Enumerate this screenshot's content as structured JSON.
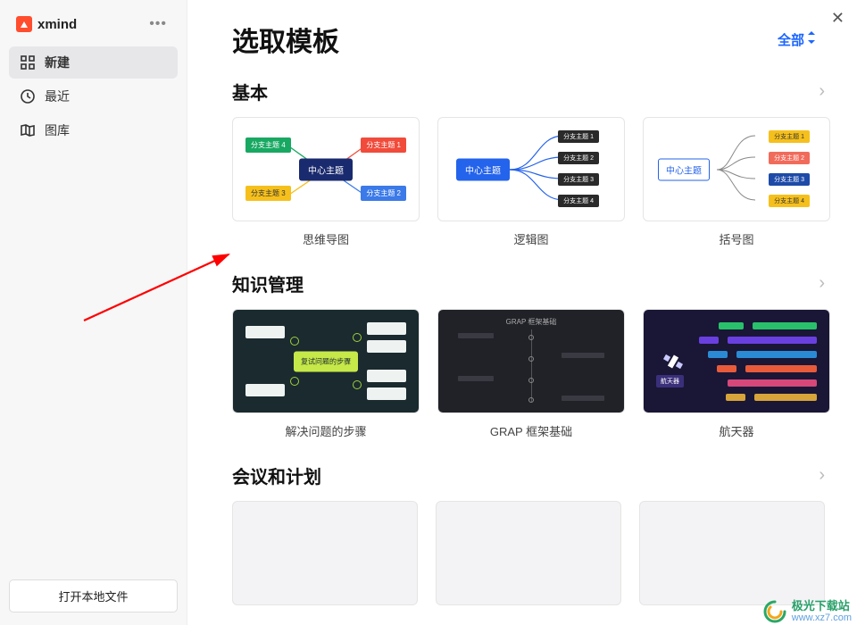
{
  "brand": {
    "name": "xmind"
  },
  "close": "✕",
  "sidebar": {
    "items": [
      {
        "label": "新建",
        "icon": "grid-icon",
        "active": true
      },
      {
        "label": "最近",
        "icon": "clock-icon",
        "active": false
      },
      {
        "label": "图库",
        "icon": "map-icon",
        "active": false
      }
    ],
    "open_local": "打开本地文件"
  },
  "header": {
    "title": "选取模板",
    "filter_label": "全部"
  },
  "sections": [
    {
      "title": "基本",
      "cards": [
        {
          "label": "思维导图",
          "center": "中心主题",
          "nodes": [
            "分支主题 4",
            "分支主题 1",
            "分支主题 3",
            "分支主题 2"
          ]
        },
        {
          "label": "逻辑图",
          "center": "中心主题",
          "nodes": [
            "分支主题 1",
            "分支主题 2",
            "分支主题 3",
            "分支主题 4"
          ]
        },
        {
          "label": "括号图",
          "center": "中心主题",
          "nodes": [
            "分支主题 1",
            "分支主题 2",
            "分支主题 3",
            "分支主题 4"
          ]
        }
      ]
    },
    {
      "title": "知识管理",
      "cards": [
        {
          "label": "解决问题的步骤",
          "center": "复试问题的步骤"
        },
        {
          "label": "GRAP 框架基础",
          "center": "GRAP 框架基础"
        },
        {
          "label": "航天器",
          "center": "航天器"
        }
      ]
    },
    {
      "title": "会议和计划",
      "cards": []
    }
  ],
  "watermark": {
    "cn": "极光下载站",
    "url": "www.xz7.com"
  }
}
